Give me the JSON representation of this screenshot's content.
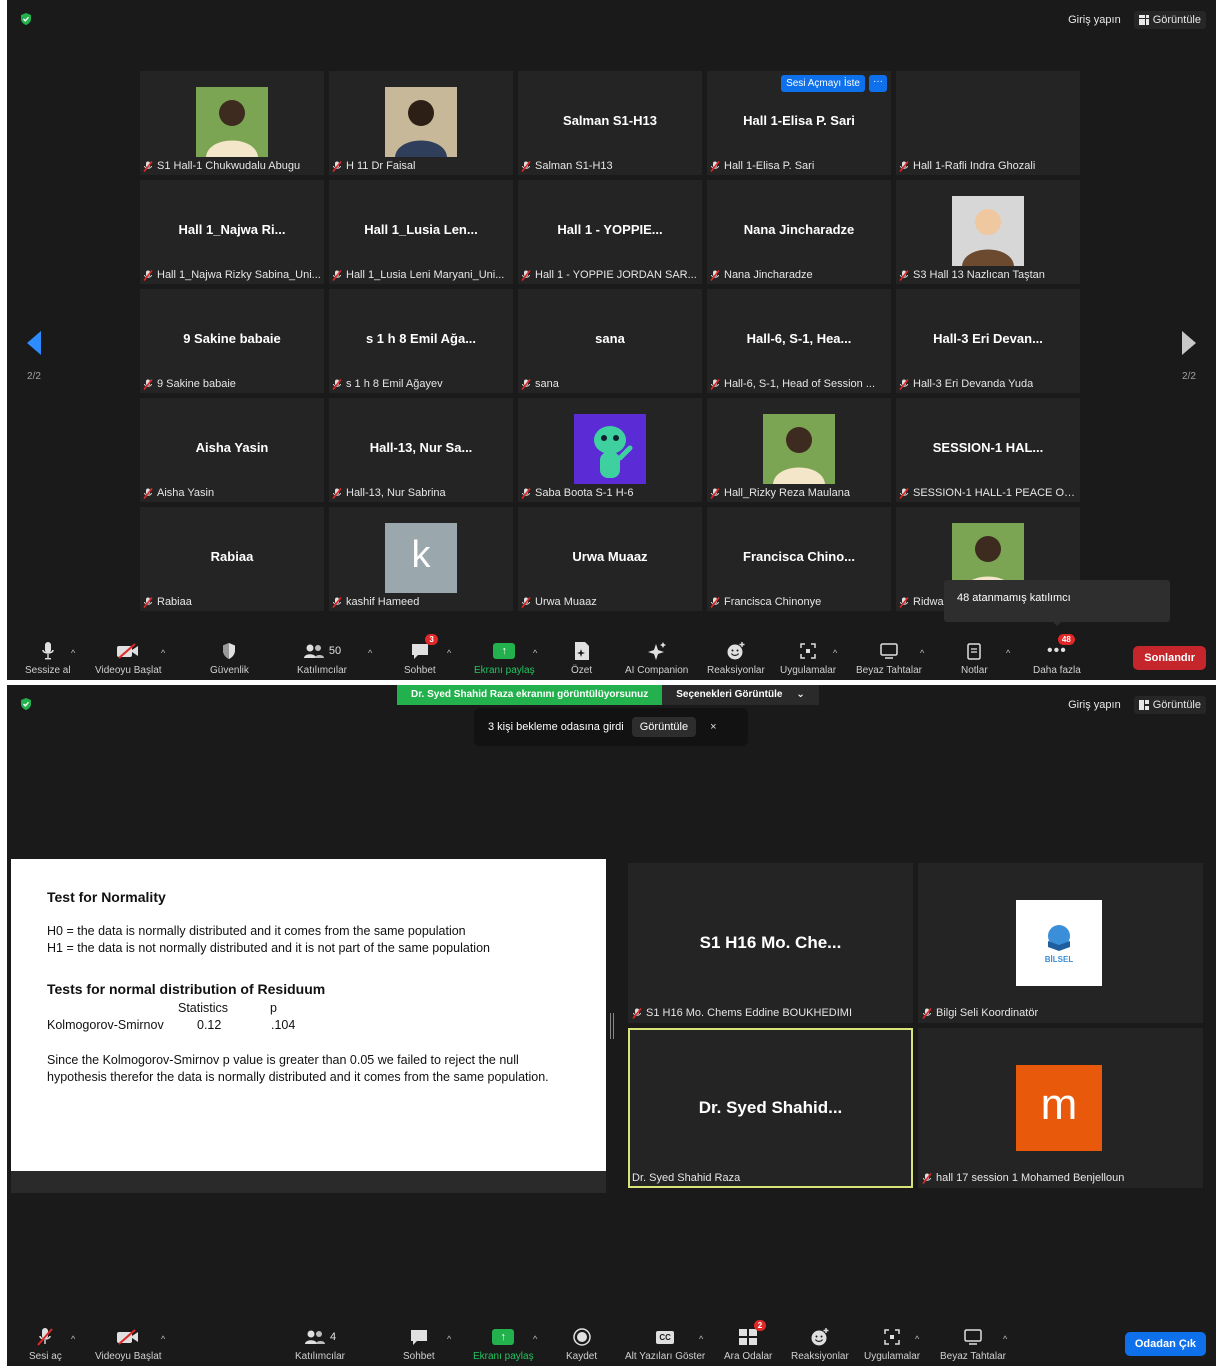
{
  "colors": {
    "accent_blue": "#0e71eb",
    "share_green": "#22b14c",
    "end_red": "#c4262c",
    "active_border": "#d8e37a",
    "badge_red": "#e02828",
    "m_avatar": "#e8590c",
    "k_avatar": "#9aa7ad"
  },
  "top": {
    "sign_in": "Giriş yapın",
    "view": "Görüntüle",
    "page_indicator": "2/2",
    "ask_unmute": "Sesi Açmayı İste",
    "ask_more": "···",
    "tooltip": "48 atanmamış katılımcı",
    "tiles": [
      {
        "big": "",
        "foot": "S1 Hall-1 Chukwudalu Abugu",
        "photo": "person-photo"
      },
      {
        "big": "",
        "foot": "H 11 Dr Faisal",
        "photo": "person-photo"
      },
      {
        "big": "Salman S1-H13",
        "foot": "Salman S1-H13"
      },
      {
        "big": "Hall 1-Elisa P. Sari",
        "foot": "Hall 1-Elisa P. Sari"
      },
      {
        "big": "",
        "foot": "Hall 1-Rafli Indra Ghozali"
      },
      {
        "big": "Hall 1_Najwa Ri...",
        "foot": "Hall 1_Najwa Rizky Sabina_Uni..."
      },
      {
        "big": "Hall 1_Lusia Len...",
        "foot": "Hall 1_Lusia Leni Maryani_Uni..."
      },
      {
        "big": "Hall 1 - YOPPIE...",
        "foot": "Hall 1 - YOPPIE JORDAN SAR..."
      },
      {
        "big": "Nana Jincharadze",
        "foot": "Nana Jincharadze"
      },
      {
        "big": "",
        "foot": "S3 Hall 13 Nazlıcan Taştan",
        "photo": "person-photo"
      },
      {
        "big": "9 Sakine babaie",
        "foot": "9 Sakine babaie"
      },
      {
        "big": "s 1 h 8 Emil Ağa...",
        "foot": "s 1 h 8 Emil Ağayev"
      },
      {
        "big": "sana",
        "foot": "sana"
      },
      {
        "big": "Hall-6, S-1, Hea...",
        "foot": "Hall-6, S-1, Head of Session ..."
      },
      {
        "big": "Hall-3 Eri Devan...",
        "foot": "Hall-3 Eri Devanda Yuda"
      },
      {
        "big": "Aisha Yasin",
        "foot": "Aisha Yasin"
      },
      {
        "big": "Hall-13, Nur Sa...",
        "foot": "Hall-13, Nur Sabrina"
      },
      {
        "big": "",
        "foot": "Saba Boota S-1 H-6",
        "photo": "alien-avatar"
      },
      {
        "big": "",
        "foot": "Hall_Rizky Reza Maulana",
        "photo": "person-photo"
      },
      {
        "big": "SESSION-1 HAL...",
        "foot": "SESSION-1 HALL-1 PEACE OR..."
      },
      {
        "big": "Rabiaa",
        "foot": "Rabiaa"
      },
      {
        "big": "",
        "foot": "kashif Hameed",
        "avatar_letter": "k"
      },
      {
        "big": "Urwa Muaaz",
        "foot": "Urwa Muaaz"
      },
      {
        "big": "Francisca Chino...",
        "foot": "Francisca Chinonye"
      },
      {
        "big": "",
        "foot": "Ridwan",
        "photo": "person-photo"
      }
    ],
    "toolbar": {
      "mute": "Sessize al",
      "video": "Videoyu Başlat",
      "security": "Güvenlik",
      "participants": "Katılımcılar",
      "participants_count": "50",
      "chat": "Sohbet",
      "chat_badge": "3",
      "share": "Ekranı paylaş",
      "summary": "Özet",
      "ai": "AI Companion",
      "reactions": "Reaksiyonlar",
      "apps": "Uygulamalar",
      "whiteboards": "Beyaz Tahtalar",
      "notes": "Notlar",
      "more": "Daha fazla",
      "more_badge": "48",
      "end": "Sonlandır"
    }
  },
  "bottom": {
    "share_banner": "Dr. Syed Shahid Raza ekranını görüntülüyorsunuz",
    "view_options": "Seçenekleri Görüntüle",
    "sign_in": "Giriş yapın",
    "view": "Görüntüle",
    "notification": {
      "text": "3 kişi bekleme odasına girdi",
      "button": "Görüntüle",
      "close": "×"
    },
    "slide": {
      "title": "Test for Normality",
      "h0": "H0 = the data is normally distributed and it comes from the same population",
      "h1": "H1 = the data is not normally distributed and it is not part of the same population",
      "section": "Tests for normal distribution of Residuum",
      "col_stat": "Statistics",
      "col_p": "p",
      "row_label": "Kolmogorov-Smirnov",
      "row_stat": "0.12",
      "row_p": ".104",
      "conclusion": "Since the Kolmogorov-Smirnov p value is greater than 0.05 we failed to reject the null hypothesis therefor the data is normally distributed and it comes from the same population."
    },
    "tiles": [
      {
        "big": "S1 H16 Mo.  Che...",
        "foot": "S1 H16 Mo.  Chems Eddine BOUKHEDIMI"
      },
      {
        "big": "",
        "foot": "Bilgi Seli Koordinatör",
        "logo_text": "BİLSEL"
      },
      {
        "big": "Dr. Syed Shahid...",
        "foot": "Dr. Syed Shahid Raza"
      },
      {
        "big": "",
        "foot": "hall 17 session 1 Mohamed Benjelloun",
        "avatar_letter": "m"
      }
    ],
    "toolbar": {
      "unmute": "Sesi aç",
      "video": "Videoyu Başlat",
      "participants": "Katılımcılar",
      "participants_count": "4",
      "chat": "Sohbet",
      "share": "Ekranı paylaş",
      "record": "Kaydet",
      "captions": "Alt Yazıları Göster",
      "breakout": "Ara Odalar",
      "breakout_badge": "2",
      "reactions": "Reaksiyonlar",
      "apps": "Uygulamalar",
      "whiteboards": "Beyaz Tahtalar",
      "leave": "Odadan Çık"
    }
  }
}
